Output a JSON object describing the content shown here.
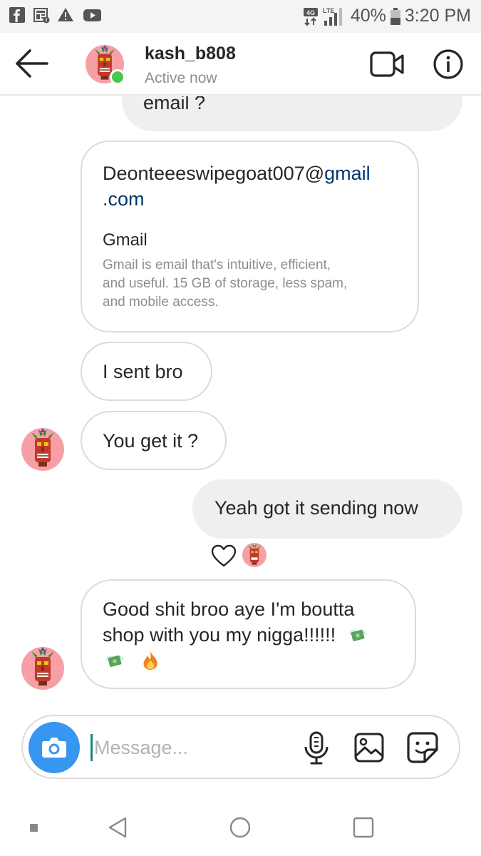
{
  "status_bar": {
    "battery": "40%",
    "time": "3:20 PM",
    "network_badge": "4G",
    "lte_label": "LTE",
    "left_icons": [
      "facebook-icon",
      "news-icon",
      "alert-icon",
      "youtube-icon"
    ]
  },
  "header": {
    "username": "kash_b808",
    "status": "Active now",
    "icons": [
      "back-arrow-icon",
      "video-call-icon",
      "info-icon"
    ]
  },
  "messages": [
    {
      "id": "m1",
      "direction": "outgoing",
      "text": "email ?",
      "partial": true
    },
    {
      "id": "m2",
      "direction": "incoming",
      "type": "link_preview",
      "link_text": "Deonteeeswipegoat007@",
      "link_domain": "gmail",
      "link_tld": ".com",
      "preview_title": "Gmail",
      "preview_lines": [
        "Gmail is email that's intuitive, efficient,",
        "and useful. 15 GB of storage, less spam,",
        "and mobile access."
      ]
    },
    {
      "id": "m3",
      "direction": "incoming",
      "text": "I sent bro"
    },
    {
      "id": "m4",
      "direction": "incoming",
      "text": "You get it ?",
      "show_avatar": true
    },
    {
      "id": "m5",
      "direction": "outgoing",
      "text": "Yeah got it sending now",
      "reaction": "heart-icon"
    },
    {
      "id": "m6",
      "direction": "incoming",
      "show_avatar": true,
      "lines": [
        "Good shit broo aye I'm boutta",
        "shop with you my nigga!!!!!!"
      ],
      "emojis": [
        "money-with-wings-emoji",
        "money-with-wings-emoji",
        "fire-emoji"
      ]
    }
  ],
  "composer": {
    "placeholder": "Message...",
    "value": "",
    "icons": [
      "camera-icon",
      "microphone-icon",
      "gallery-icon",
      "sticker-icon"
    ]
  },
  "nav_bar": {
    "icons": [
      "recent-dot-icon",
      "back-triangle-icon",
      "home-circle-icon",
      "overview-square-icon"
    ]
  },
  "colors": {
    "accent_blue": "#3797f0",
    "online_green": "#44c94a",
    "link_blue": "#00376b",
    "outgoing_bubble": "#efefef",
    "incoming_border": "#dbdbdb",
    "avatar_bg": "#f6a0a5"
  }
}
